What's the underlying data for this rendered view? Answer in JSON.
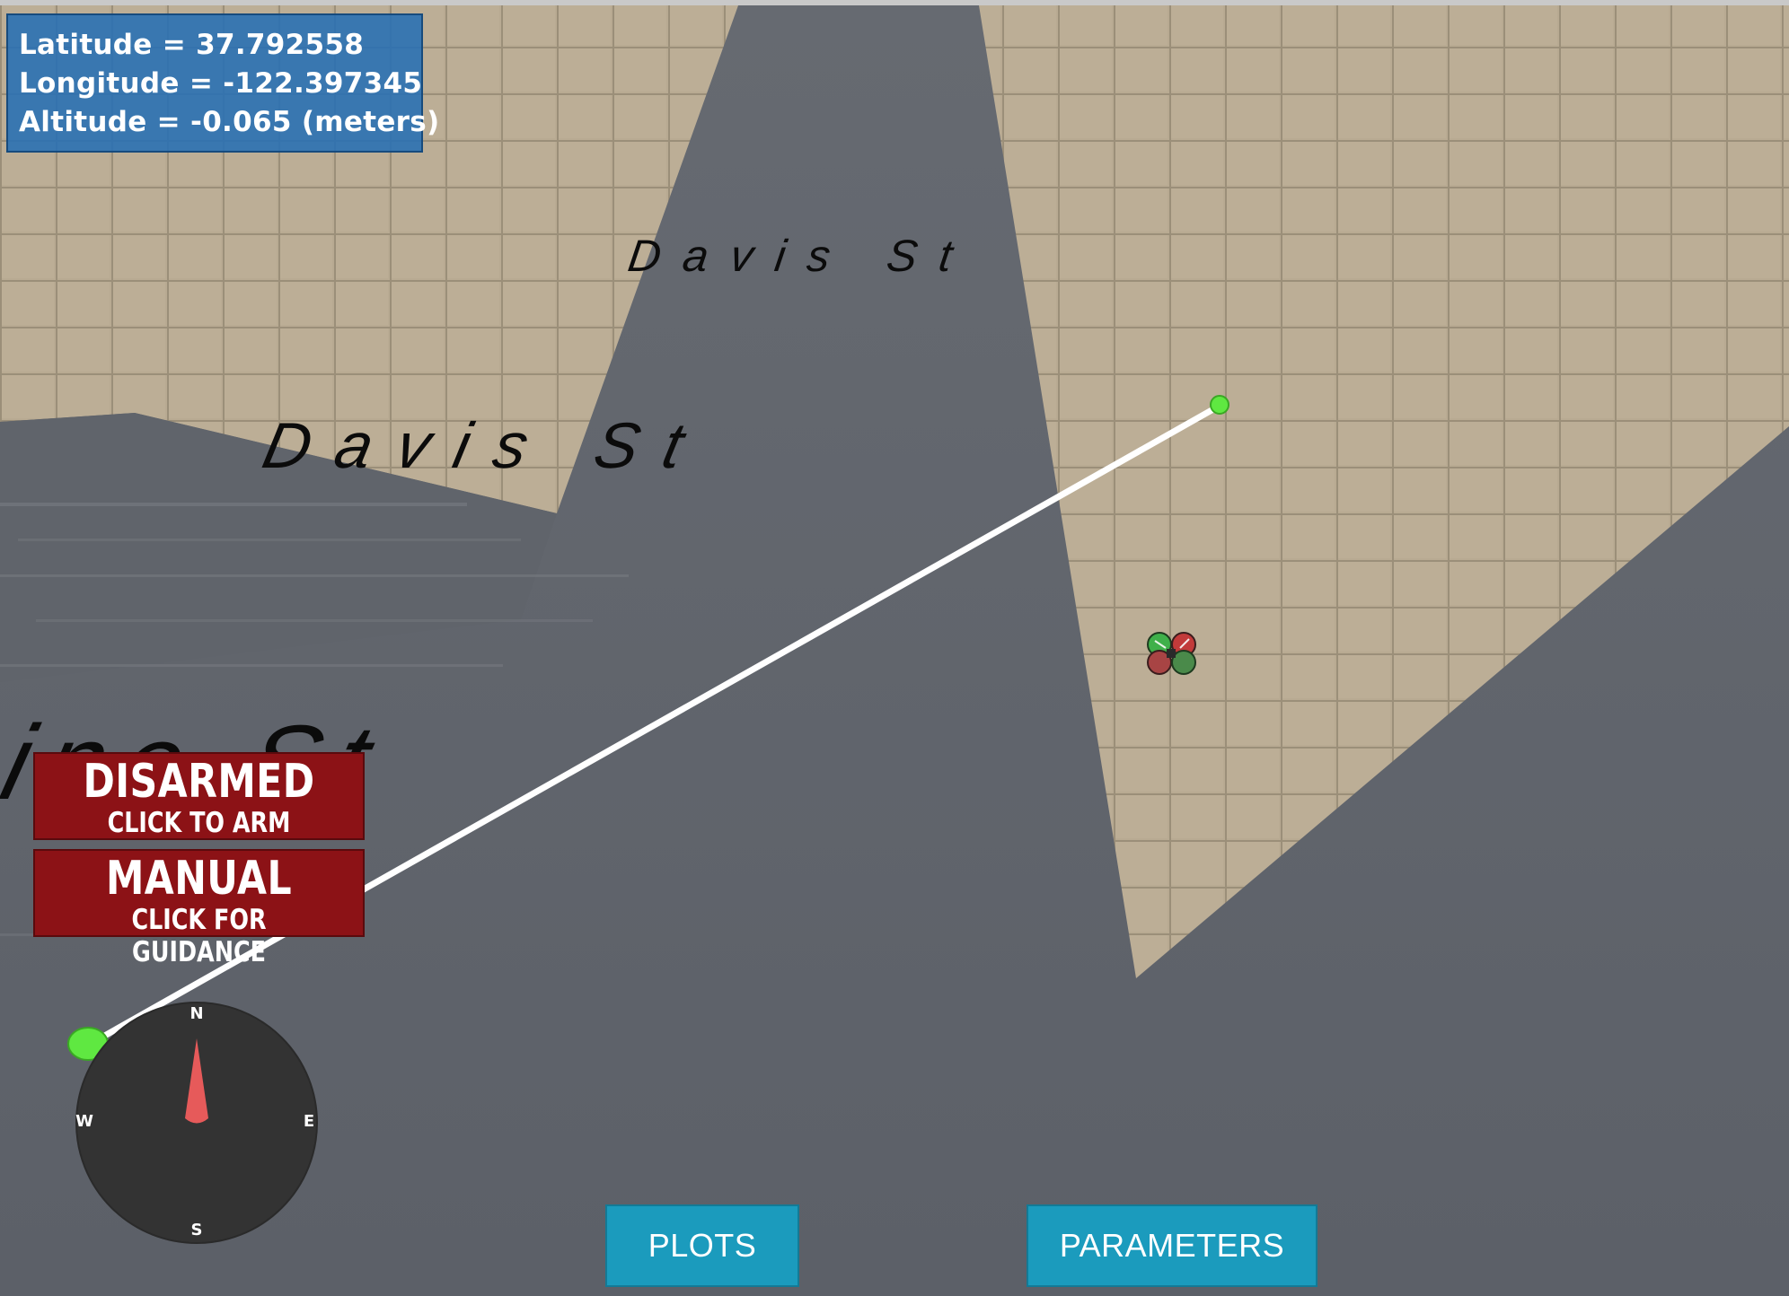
{
  "gps": {
    "latitude": "Latitude = 37.792558",
    "longitude": "Longitude = -122.397345",
    "altitude": "Altitude = -0.065 (meters)"
  },
  "map_labels": {
    "street_1": "Davis St",
    "street_2": "Davis St",
    "street_3": "Pine St"
  },
  "arm_button": {
    "state": "DISARMED",
    "action": "CLICK TO ARM"
  },
  "mode_button": {
    "state": "MANUAL",
    "action": "CLICK FOR GUIDANCE"
  },
  "compass": {
    "north": "N",
    "south": "S",
    "east": "E",
    "west": "W",
    "heading_deg": 0
  },
  "bottom_buttons": {
    "plots": "PLOTS",
    "parameters": "PARAMETERS"
  },
  "colors": {
    "ground": "#b9ab93",
    "road": "#5f636b",
    "gps_panel": "#2770b4",
    "mode_button": "#8c1216",
    "bottom_button": "#1b9bbd",
    "waypoint": "#56e83a",
    "compass_needle": "#e65a5a"
  }
}
